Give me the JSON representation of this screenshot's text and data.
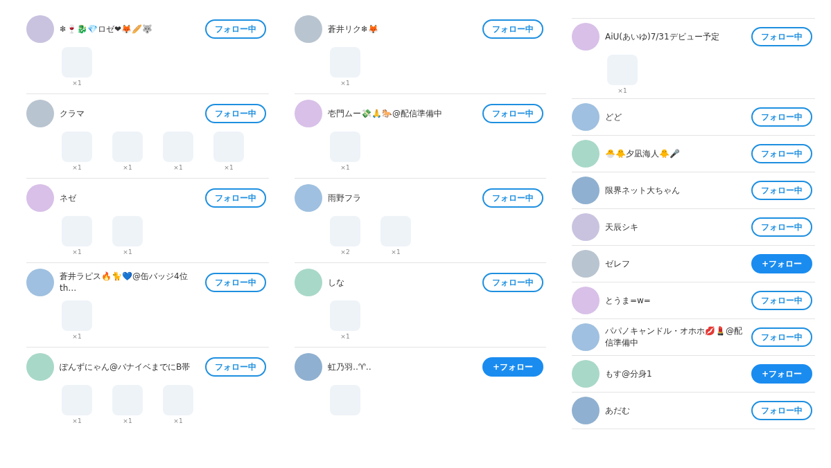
{
  "columns": [
    {
      "users": [
        {
          "name": "❄🍷🐉💎ロゼ❤🦊🥖🐺",
          "button": "フォロー中",
          "following": true,
          "stickers": [
            {
              "kind": "sticker",
              "count": "×1"
            }
          ]
        },
        {
          "name": "クラマ",
          "button": "フォロー中",
          "following": true,
          "stickers": [
            {
              "kind": "sticker",
              "count": "×1"
            },
            {
              "kind": "sticker",
              "count": "×1"
            },
            {
              "kind": "sticker",
              "count": "×1"
            },
            {
              "kind": "sticker",
              "count": "×1"
            }
          ]
        },
        {
          "name": "ネゼ",
          "button": "フォロー中",
          "following": true,
          "stickers": [
            {
              "kind": "sticker",
              "count": "×1"
            },
            {
              "kind": "sticker",
              "count": "×1"
            }
          ]
        },
        {
          "name": "蒼井ラピス🔥🐈💙@缶バッジ4位th…",
          "button": "フォロー中",
          "following": true,
          "stickers": [
            {
              "kind": "sticker",
              "count": "×1"
            }
          ]
        },
        {
          "name": "ぽんずにゃん@バナイベまでにB帯",
          "button": "フォロー中",
          "following": true,
          "stickers": [
            {
              "kind": "sticker",
              "count": "×1"
            },
            {
              "kind": "sticker",
              "count": "×1"
            },
            {
              "kind": "sticker",
              "count": "×1"
            }
          ]
        }
      ]
    },
    {
      "users": [
        {
          "name": "蒼井リク❄🦊",
          "button": "フォロー中",
          "following": true,
          "stickers": [
            {
              "kind": "sticker",
              "count": "×1"
            }
          ]
        },
        {
          "name": "壱門ムー💸🙏🐎@配信準備中",
          "button": "フォロー中",
          "following": true,
          "stickers": [
            {
              "kind": "sticker",
              "count": "×1"
            }
          ]
        },
        {
          "name": "雨野フラ",
          "button": "フォロー中",
          "following": true,
          "stickers": [
            {
              "kind": "sticker",
              "count": "×2"
            },
            {
              "kind": "sticker",
              "count": "×1"
            }
          ]
        },
        {
          "name": "しな",
          "button": "フォロー中",
          "following": true,
          "stickers": [
            {
              "kind": "sticker",
              "count": "×1"
            }
          ]
        },
        {
          "name": "虹乃羽‥♈‥",
          "button": "+フォロー",
          "following": false,
          "stickers": [
            {
              "kind": "sticker"
            }
          ]
        }
      ]
    },
    {
      "users": [
        {
          "name": "AiU(あいゆ)7/31デビュー予定",
          "button": "フォロー中",
          "following": true,
          "stickers": [
            {
              "kind": "sticker",
              "count": "×1"
            }
          ]
        },
        {
          "name": "どど",
          "button": "フォロー中",
          "following": true
        },
        {
          "name": "🐣🐥夕凪海人🐥🎤",
          "button": "フォロー中",
          "following": true
        },
        {
          "name": "限界ネット大ちゃん",
          "button": "フォロー中",
          "following": true
        },
        {
          "name": "天辰シキ",
          "button": "フォロー中",
          "following": true
        },
        {
          "name": "ゼレフ",
          "button": "+フォロー",
          "following": false
        },
        {
          "name": "とうま=w=",
          "button": "フォロー中",
          "following": true
        },
        {
          "name": "パパノキャンドル・オホホ💋💄@配信準備中",
          "button": "フォロー中",
          "following": true
        },
        {
          "name": "もす@分身1",
          "button": "+フォロー",
          "following": false
        },
        {
          "name": "あだむ",
          "button": "フォロー中",
          "following": true
        }
      ]
    }
  ]
}
